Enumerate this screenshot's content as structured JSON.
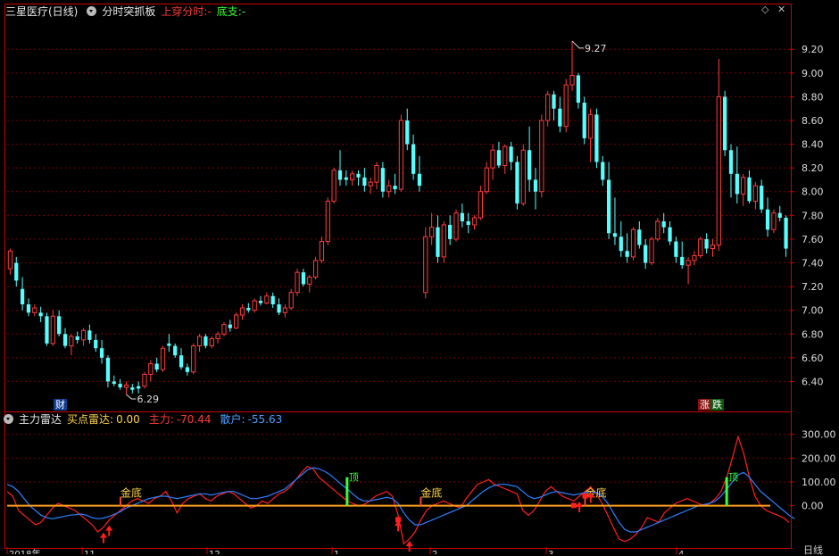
{
  "header": {
    "stock_title": "三星医疗(日线)",
    "indicator_name": "分时突抓板",
    "cross_label": "上穿分时:",
    "cross_value": "-",
    "support_label": "底支:",
    "support_value": "-"
  },
  "window_controls": {
    "diamond_icon": "◇",
    "close_icon": "✕"
  },
  "sub_header": {
    "indicator_name": "主力雷达",
    "buy_label": "买点雷达:",
    "buy_value": "0.00",
    "main_label": "主力:",
    "main_value": "-70.44",
    "retail_label": "散户:",
    "retail_value": "-55.63"
  },
  "markers": {
    "finance_tag": "财",
    "limit_up_tag": "涨",
    "limit_down_tag": "跌",
    "high_price": "9.27",
    "low_price": "6.29"
  },
  "x_axis": {
    "labels": [
      "2018年",
      "11",
      "12",
      "1",
      "2",
      "3",
      "4"
    ],
    "period_label": "日线"
  },
  "colors": {
    "up": "#ff3c3c",
    "down": "#54ffff",
    "grid": "#7a0000",
    "main_line": "#ff2020",
    "retail_line": "#2f7fff",
    "zero_line": "#ff9f20",
    "signal_gold": "#ffd24a",
    "signal_top": "#37ff37"
  },
  "chart_data": [
    {
      "type": "candlestick",
      "title": "三星医疗(日线)",
      "y_ticks": [
        6.4,
        6.6,
        6.8,
        7.0,
        7.2,
        7.4,
        7.6,
        7.8,
        8.0,
        8.2,
        8.4,
        8.6,
        8.8,
        9.0,
        9.2
      ],
      "ylim": [
        6.17,
        9.45
      ],
      "candles": [
        [
          7.35,
          7.52,
          7.3,
          7.5
        ],
        [
          7.4,
          7.45,
          7.2,
          7.25
        ],
        [
          7.18,
          7.28,
          7.0,
          7.05
        ],
        [
          7.05,
          7.1,
          6.95,
          6.98
        ],
        [
          6.98,
          7.05,
          6.95,
          7.02
        ],
        [
          6.98,
          7.03,
          6.9,
          6.95
        ],
        [
          6.95,
          6.98,
          6.7,
          6.72
        ],
        [
          6.72,
          7.0,
          6.7,
          6.95
        ],
        [
          6.95,
          7.0,
          6.78,
          6.8
        ],
        [
          6.8,
          6.85,
          6.68,
          6.7
        ],
        [
          6.7,
          6.8,
          6.62,
          6.78
        ],
        [
          6.78,
          6.82,
          6.72,
          6.75
        ],
        [
          6.75,
          6.85,
          6.7,
          6.83
        ],
        [
          6.83,
          6.88,
          6.72,
          6.75
        ],
        [
          6.75,
          6.8,
          6.65,
          6.68
        ],
        [
          6.68,
          6.75,
          6.55,
          6.6
        ],
        [
          6.6,
          6.62,
          6.35,
          6.4
        ],
        [
          6.4,
          6.45,
          6.36,
          6.38
        ],
        [
          6.38,
          6.42,
          6.33,
          6.35
        ],
        [
          6.35,
          6.4,
          6.29,
          6.37
        ],
        [
          6.35,
          6.38,
          6.3,
          6.33
        ],
        [
          6.36,
          6.4,
          6.3,
          6.34
        ],
        [
          6.36,
          6.48,
          6.34,
          6.46
        ],
        [
          6.46,
          6.58,
          6.4,
          6.55
        ],
        [
          6.55,
          6.6,
          6.48,
          6.5
        ],
        [
          6.5,
          6.7,
          6.48,
          6.68
        ],
        [
          6.72,
          6.8,
          6.65,
          6.7
        ],
        [
          6.7,
          6.72,
          6.6,
          6.62
        ],
        [
          6.62,
          6.68,
          6.5,
          6.52
        ],
        [
          6.52,
          6.55,
          6.45,
          6.48
        ],
        [
          6.48,
          6.72,
          6.46,
          6.7
        ],
        [
          6.7,
          6.8,
          6.65,
          6.78
        ],
        [
          6.78,
          6.8,
          6.68,
          6.7
        ],
        [
          6.7,
          6.78,
          6.68,
          6.76
        ],
        [
          6.76,
          6.82,
          6.72,
          6.8
        ],
        [
          6.8,
          6.9,
          6.78,
          6.88
        ],
        [
          6.88,
          6.92,
          6.82,
          6.85
        ],
        [
          6.85,
          6.98,
          6.84,
          6.96
        ],
        [
          6.96,
          7.05,
          6.92,
          7.02
        ],
        [
          7.02,
          7.06,
          6.98,
          7.0
        ],
        [
          7.0,
          7.1,
          6.98,
          7.08
        ],
        [
          7.08,
          7.12,
          7.04,
          7.06
        ],
        [
          7.06,
          7.15,
          7.05,
          7.12
        ],
        [
          7.12,
          7.15,
          7.02,
          7.05
        ],
        [
          7.05,
          7.1,
          6.96,
          6.98
        ],
        [
          6.98,
          7.05,
          6.94,
          7.02
        ],
        [
          7.02,
          7.18,
          7.0,
          7.15
        ],
        [
          7.15,
          7.35,
          7.12,
          7.32
        ],
        [
          7.32,
          7.35,
          7.2,
          7.22
        ],
        [
          7.22,
          7.3,
          7.15,
          7.28
        ],
        [
          7.28,
          7.45,
          7.26,
          7.42
        ],
        [
          7.42,
          7.62,
          7.4,
          7.58
        ],
        [
          7.58,
          7.95,
          7.55,
          7.92
        ],
        [
          7.92,
          8.2,
          7.9,
          8.18
        ],
        [
          8.18,
          8.35,
          8.05,
          8.1
        ],
        [
          8.12,
          8.18,
          8.05,
          8.1
        ],
        [
          8.1,
          8.18,
          8.05,
          8.15
        ],
        [
          8.15,
          8.18,
          8.05,
          8.12
        ],
        [
          8.12,
          8.2,
          8.0,
          8.05
        ],
        [
          8.05,
          8.12,
          7.98,
          8.08
        ],
        [
          8.08,
          8.25,
          8.02,
          8.22
        ],
        [
          8.2,
          8.25,
          7.95,
          8.0
        ],
        [
          8.0,
          8.1,
          7.95,
          8.05
        ],
        [
          8.05,
          8.15,
          7.98,
          8.02
        ],
        [
          8.02,
          8.65,
          8.0,
          8.6
        ],
        [
          8.6,
          8.7,
          8.35,
          8.4
        ],
        [
          8.4,
          8.48,
          8.1,
          8.15
        ],
        [
          8.15,
          8.3,
          8.0,
          8.05
        ],
        [
          7.15,
          7.7,
          7.1,
          7.62
        ],
        [
          7.62,
          7.82,
          7.55,
          7.7
        ],
        [
          7.7,
          7.8,
          7.4,
          7.45
        ],
        [
          7.45,
          7.75,
          7.4,
          7.72
        ],
        [
          7.72,
          7.8,
          7.55,
          7.6
        ],
        [
          7.6,
          7.85,
          7.58,
          7.82
        ],
        [
          7.82,
          7.9,
          7.7,
          7.75
        ],
        [
          7.75,
          7.82,
          7.65,
          7.72
        ],
        [
          7.72,
          7.8,
          7.68,
          7.78
        ],
        [
          7.78,
          8.05,
          7.76,
          8.0
        ],
        [
          8.0,
          8.25,
          7.98,
          8.2
        ],
        [
          8.2,
          8.4,
          8.1,
          8.35
        ],
        [
          8.35,
          8.42,
          8.2,
          8.22
        ],
        [
          8.22,
          8.4,
          8.15,
          8.38
        ],
        [
          8.38,
          8.42,
          8.18,
          8.25
        ],
        [
          8.25,
          8.3,
          7.85,
          7.9
        ],
        [
          7.9,
          8.4,
          7.88,
          8.35
        ],
        [
          8.35,
          8.55,
          8.0,
          8.1
        ],
        [
          8.1,
          8.2,
          7.85,
          8.0
        ],
        [
          8.0,
          8.65,
          7.95,
          8.6
        ],
        [
          8.6,
          8.85,
          8.55,
          8.82
        ],
        [
          8.82,
          8.85,
          8.6,
          8.7
        ],
        [
          8.7,
          8.8,
          8.5,
          8.55
        ],
        [
          8.55,
          8.95,
          8.5,
          8.9
        ],
        [
          8.9,
          9.27,
          8.85,
          8.98
        ],
        [
          8.98,
          9.0,
          8.7,
          8.75
        ],
        [
          8.75,
          8.8,
          8.4,
          8.45
        ],
        [
          8.45,
          8.7,
          8.25,
          8.65
        ],
        [
          8.65,
          8.7,
          8.2,
          8.25
        ],
        [
          8.25,
          8.3,
          8.05,
          8.1
        ],
        [
          8.1,
          8.25,
          7.6,
          7.65
        ],
        [
          7.65,
          7.95,
          7.55,
          7.62
        ],
        [
          7.62,
          7.75,
          7.45,
          7.5
        ],
        [
          7.5,
          7.65,
          7.4,
          7.45
        ],
        [
          7.45,
          7.7,
          7.42,
          7.68
        ],
        [
          7.68,
          7.75,
          7.52,
          7.55
        ],
        [
          7.55,
          7.6,
          7.35,
          7.4
        ],
        [
          7.4,
          7.62,
          7.38,
          7.6
        ],
        [
          7.6,
          7.78,
          7.58,
          7.75
        ],
        [
          7.75,
          7.82,
          7.65,
          7.7
        ],
        [
          7.7,
          7.75,
          7.55,
          7.58
        ],
        [
          7.58,
          7.62,
          7.4,
          7.45
        ],
        [
          7.45,
          7.58,
          7.35,
          7.38
        ],
        [
          7.38,
          7.45,
          7.22,
          7.42
        ],
        [
          7.42,
          7.5,
          7.38,
          7.46
        ],
        [
          7.46,
          7.62,
          7.44,
          7.6
        ],
        [
          7.6,
          7.65,
          7.48,
          7.52
        ],
        [
          7.52,
          7.6,
          7.45,
          7.55
        ],
        [
          7.55,
          9.12,
          7.5,
          8.8
        ],
        [
          8.8,
          8.85,
          8.3,
          8.35
        ],
        [
          8.35,
          8.4,
          7.95,
          8.15
        ],
        [
          8.15,
          8.38,
          7.9,
          7.98
        ],
        [
          7.98,
          8.15,
          7.88,
          8.12
        ],
        [
          8.12,
          8.18,
          7.9,
          7.92
        ],
        [
          7.92,
          8.08,
          7.85,
          8.05
        ],
        [
          8.05,
          8.1,
          7.82,
          7.85
        ],
        [
          7.85,
          7.95,
          7.62,
          7.68
        ],
        [
          7.68,
          7.85,
          7.65,
          7.82
        ],
        [
          7.82,
          7.88,
          7.75,
          7.78
        ],
        [
          7.78,
          7.8,
          7.45,
          7.52
        ]
      ]
    },
    {
      "type": "line",
      "title": "主力雷达",
      "y_ticks": [
        300.0,
        200.0,
        100.0,
        0.0
      ],
      "ylim": [
        -170,
        340
      ],
      "series": [
        {
          "name": "主力",
          "values": [
            60,
            40,
            -20,
            -40,
            -60,
            -80,
            -70,
            -40,
            -10,
            10,
            0,
            -10,
            -20,
            -40,
            -60,
            -80,
            -110,
            -90,
            -60,
            -40,
            -20,
            0,
            20,
            30,
            20,
            10,
            30,
            40,
            60,
            20,
            -30,
            10,
            30,
            40,
            50,
            30,
            20,
            40,
            50,
            60,
            50,
            30,
            10,
            -10,
            0,
            20,
            10,
            30,
            50,
            60,
            80,
            110,
            140,
            165,
            155,
            120,
            100,
            80,
            60,
            40,
            20,
            10,
            0,
            5,
            20,
            40,
            50,
            60,
            40,
            -40,
            -160,
            -140,
            -110,
            -60,
            -20,
            0,
            10,
            20,
            10,
            0,
            -10,
            30,
            60,
            90,
            100,
            110,
            90,
            80,
            70,
            60,
            50,
            -20,
            -40,
            -20,
            20,
            60,
            80,
            60,
            40,
            30,
            20,
            40,
            60,
            80,
            50,
            10,
            -40,
            -90,
            -140,
            -150,
            -140,
            -120,
            -90,
            -50,
            -60,
            -70,
            -30,
            -10,
            10,
            20,
            30,
            20,
            10,
            0,
            10,
            30,
            60,
            120,
            200,
            290,
            220,
            120,
            40,
            0,
            -20,
            -30,
            -40,
            -50,
            -70
          ]
        },
        {
          "name": "散户",
          "values": [
            90,
            80,
            60,
            30,
            0,
            -20,
            -40,
            -50,
            -55,
            -50,
            -45,
            -40,
            -38,
            -35,
            -40,
            -50,
            -55,
            -52,
            -45,
            -35,
            -25,
            -10,
            0,
            10,
            20,
            30,
            35,
            40,
            40,
            35,
            30,
            35,
            40,
            45,
            50,
            50,
            45,
            50,
            55,
            60,
            60,
            50,
            40,
            30,
            30,
            35,
            40,
            50,
            60,
            70,
            90,
            110,
            130,
            150,
            160,
            155,
            145,
            130,
            110,
            90,
            70,
            50,
            30,
            20,
            20,
            25,
            30,
            35,
            30,
            10,
            -30,
            -60,
            -80,
            -80,
            -70,
            -60,
            -50,
            -40,
            -30,
            -20,
            -10,
            0,
            20,
            40,
            60,
            75,
            85,
            90,
            90,
            85,
            80,
            60,
            40,
            30,
            35,
            45,
            55,
            60,
            55,
            50,
            45,
            50,
            55,
            60,
            55,
            40,
            10,
            -30,
            -70,
            -100,
            -110,
            -110,
            -100,
            -90,
            -80,
            -70,
            -60,
            -50,
            -40,
            -30,
            -20,
            -10,
            0,
            5,
            10,
            20,
            40,
            70,
            100,
            130,
            140,
            120,
            90,
            60,
            40,
            20,
            0,
            -20,
            -40,
            -55
          ]
        }
      ],
      "signals": [
        {
          "label": "金底",
          "index": 20
        },
        {
          "label": "顶",
          "index": 60
        },
        {
          "label": "金底",
          "index": 73
        },
        {
          "label": "金底",
          "index": 102
        },
        {
          "label": "顶",
          "index": 127
        }
      ]
    }
  ]
}
